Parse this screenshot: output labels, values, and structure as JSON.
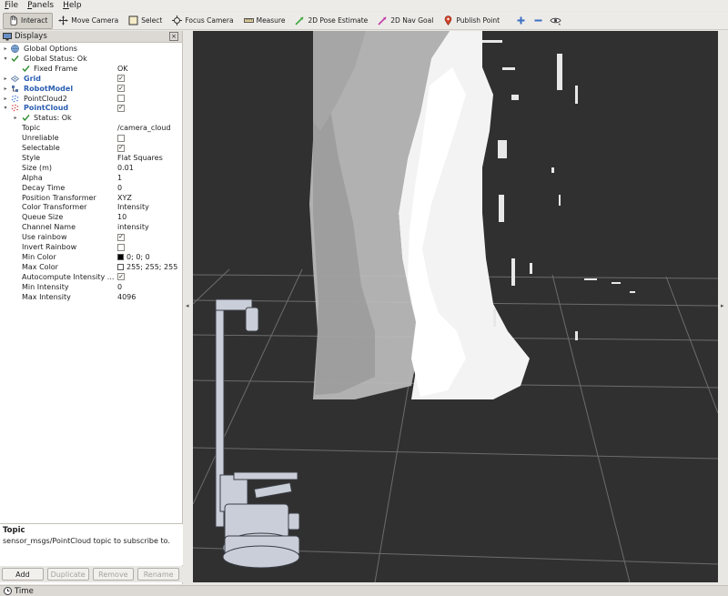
{
  "menubar": {
    "items": [
      {
        "label": "File",
        "accel": "F",
        "rest": "ile"
      },
      {
        "label": "Panels",
        "accel": "P",
        "rest": "anels"
      },
      {
        "label": "Help",
        "accel": "H",
        "rest": "elp"
      }
    ]
  },
  "toolbar": {
    "tools": [
      {
        "label": "Interact",
        "icon": "hand-icon",
        "active": true
      },
      {
        "label": "Move Camera",
        "icon": "move-camera-icon"
      },
      {
        "label": "Select",
        "icon": "select-icon"
      },
      {
        "label": "Focus Camera",
        "icon": "focus-camera-icon"
      },
      {
        "label": "Measure",
        "icon": "measure-icon"
      },
      {
        "label": "2D Pose Estimate",
        "icon": "pose-estimate-icon"
      },
      {
        "label": "2D Nav Goal",
        "icon": "nav-goal-icon"
      },
      {
        "label": "Publish Point",
        "icon": "publish-point-icon"
      }
    ],
    "extra_icons": [
      "plus-icon",
      "minus-icon",
      "eye-icon"
    ]
  },
  "displays": {
    "title": "Displays",
    "rows": [
      {
        "label": "Global Options",
        "indent": 0,
        "arrow": "right",
        "icon": "globe-icon"
      },
      {
        "label": "Global Status: Ok",
        "indent": 0,
        "arrow": "down",
        "icon": "check-icon"
      },
      {
        "label": "Fixed Frame",
        "indent": 1,
        "icon": "check-icon",
        "value": "OK"
      },
      {
        "label": "Grid",
        "indent": 0,
        "arrow": "right",
        "icon": "grid-icon",
        "blue": true,
        "checkbox": true
      },
      {
        "label": "RobotModel",
        "indent": 0,
        "arrow": "right",
        "icon": "robot-model-icon",
        "blue": true,
        "checkbox": true
      },
      {
        "label": "PointCloud2",
        "indent": 0,
        "arrow": "right",
        "icon": "pointcloud2-icon",
        "checkbox": false
      },
      {
        "label": "PointCloud",
        "indent": 0,
        "arrow": "down",
        "icon": "pointcloud-icon",
        "blue": true,
        "checkbox": true
      },
      {
        "label": "Status: Ok",
        "indent": 1,
        "arrow": "right",
        "icon": "check-icon"
      },
      {
        "label": "Topic",
        "indent": 2,
        "value": "/camera_cloud"
      },
      {
        "label": "Unreliable",
        "indent": 2,
        "checkbox": false
      },
      {
        "label": "Selectable",
        "indent": 2,
        "checkbox": true
      },
      {
        "label": "Style",
        "indent": 2,
        "value": "Flat Squares"
      },
      {
        "label": "Size (m)",
        "indent": 2,
        "value": "0.01"
      },
      {
        "label": "Alpha",
        "indent": 2,
        "value": "1"
      },
      {
        "label": "Decay Time",
        "indent": 2,
        "value": "0"
      },
      {
        "label": "Position Transformer",
        "indent": 2,
        "value": "XYZ"
      },
      {
        "label": "Color Transformer",
        "indent": 2,
        "value": "Intensity"
      },
      {
        "label": "Queue Size",
        "indent": 2,
        "value": "10"
      },
      {
        "label": "Channel Name",
        "indent": 2,
        "value": "intensity"
      },
      {
        "label": "Use rainbow",
        "indent": 2,
        "checkbox": true
      },
      {
        "label": "Invert Rainbow",
        "indent": 2,
        "checkbox": false
      },
      {
        "label": "Min Color",
        "indent": 2,
        "value": "0; 0; 0",
        "swatch": "#000000"
      },
      {
        "label": "Max Color",
        "indent": 2,
        "value": "255; 255; 255",
        "swatch": "#ffffff"
      },
      {
        "label": "Autocompute Intensity ...",
        "indent": 2,
        "checkbox": true
      },
      {
        "label": "Min Intensity",
        "indent": 2,
        "value": "0"
      },
      {
        "label": "Max Intensity",
        "indent": 2,
        "value": "4096"
      }
    ]
  },
  "description": {
    "title": "Topic",
    "text": "sensor_msgs/PointCloud topic to subscribe to."
  },
  "buttons": [
    {
      "label": "Add",
      "enabled": true
    },
    {
      "label": "Duplicate",
      "enabled": false
    },
    {
      "label": "Remove",
      "enabled": false
    },
    {
      "label": "Rename",
      "enabled": false
    }
  ],
  "timebar": {
    "title": "Time"
  },
  "colors": {
    "viewport_bg": "#303030",
    "grid_line": "#6e6e6e",
    "link_blue": "#2a5db0",
    "robot": "#c9ced8"
  }
}
